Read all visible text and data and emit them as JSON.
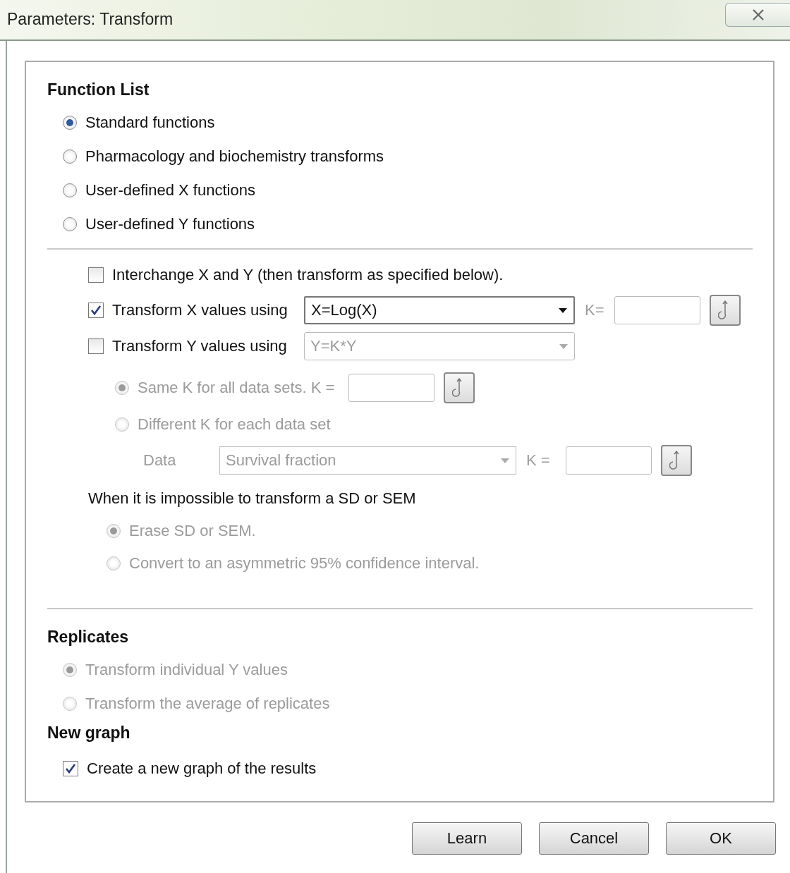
{
  "window": {
    "title": "Parameters: Transform"
  },
  "function_list": {
    "heading": "Function List",
    "options": [
      {
        "label": "Standard functions",
        "selected": true,
        "disabled": false
      },
      {
        "label": "Pharmacology and biochemistry transforms",
        "selected": false,
        "disabled": false
      },
      {
        "label": "User-defined X functions",
        "selected": false,
        "disabled": false
      },
      {
        "label": "User-defined Y functions",
        "selected": false,
        "disabled": false
      }
    ]
  },
  "interchange": {
    "label": "Interchange X and Y (then transform as specified below).",
    "checked": false
  },
  "transforms": [
    {
      "label": "Transform X values using",
      "checked": true,
      "dropdown": {
        "value": "X=Log(X)",
        "disabled": false
      },
      "k": {
        "label": "K=",
        "disabled": true
      }
    },
    {
      "label": "Transform Y values using",
      "checked": false,
      "dropdown": {
        "value": "Y=K*Y",
        "disabled": true
      }
    }
  ],
  "k_options": [
    {
      "kind": "field",
      "label": "Same K for all data sets. K =",
      "selected": true,
      "disabled": true
    },
    {
      "kind": "plain",
      "label": "Different K for each data set",
      "selected": false,
      "disabled": true
    }
  ],
  "data_row": {
    "label": "Data",
    "dropdown": {
      "value": "Survival fraction",
      "disabled": true
    },
    "k_label": "K =",
    "disabled": true
  },
  "sd_sem": {
    "heading": "When it is impossible to transform a SD or SEM",
    "options": [
      {
        "label": "Erase SD or SEM.",
        "selected": true,
        "disabled": true
      },
      {
        "label": "Convert to an asymmetric 95% confidence interval.",
        "selected": false,
        "disabled": true
      }
    ]
  },
  "replicates": {
    "heading": "Replicates",
    "options": [
      {
        "label": "Transform individual Y values",
        "selected": true,
        "disabled": true
      },
      {
        "label": "Transform the average of replicates",
        "selected": false,
        "disabled": true
      }
    ]
  },
  "new_graph": {
    "heading": "New graph",
    "option": {
      "label": "Create a new graph of the results",
      "checked": true
    }
  },
  "buttons": [
    "Learn",
    "Cancel",
    "OK"
  ]
}
